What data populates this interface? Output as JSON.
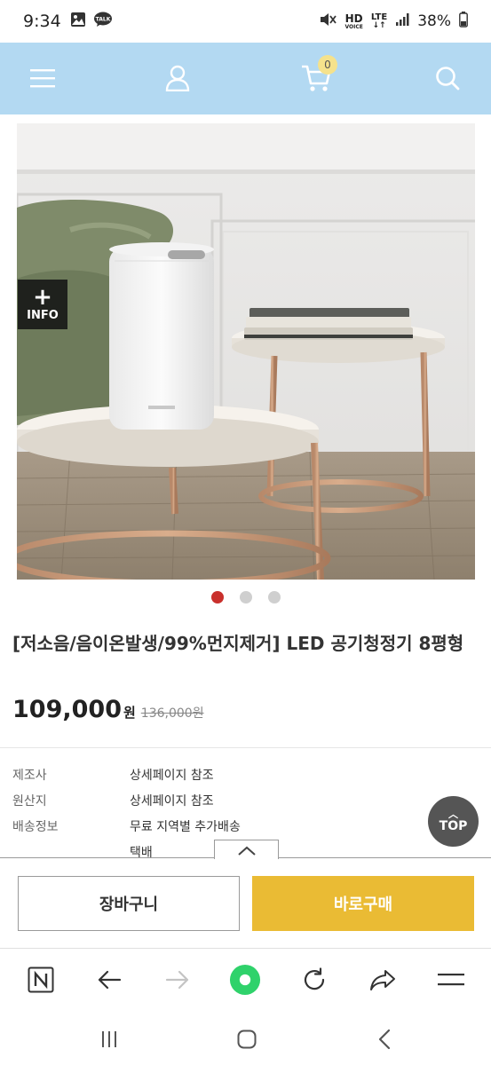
{
  "status_bar": {
    "time": "9:34",
    "battery": "38%",
    "hd_label": "HD",
    "voice_label": "VOICE",
    "lte_label": "LTE"
  },
  "header": {
    "cart_count": "0",
    "icons": [
      "menu-icon",
      "user-icon",
      "cart-icon",
      "search-icon"
    ]
  },
  "hero": {
    "info_button_label": "INFO",
    "slide_count": 3,
    "active_slide": 1
  },
  "product": {
    "title": "[저소음/음이온발생/99%먼지제거] LED 공기청정기 8평형",
    "price": "109,000",
    "currency": "원",
    "original_price": "136,000원"
  },
  "info_table": [
    {
      "key": "제조사",
      "value": "상세페이지 참조"
    },
    {
      "key": "원산지",
      "value": "상세페이지 참조"
    },
    {
      "key": "배송정보",
      "value": "무료 지역별 추가배송"
    },
    {
      "key": "",
      "value": "택배"
    }
  ],
  "top_button": {
    "label": "TOP"
  },
  "actions": {
    "cart_label": "장바구니",
    "buy_label": "바로구매"
  },
  "colors": {
    "header_bg": "#b3d9f2",
    "buy_button": "#eabb34",
    "active_dot": "#c9302c",
    "browser_home_green": "#2fd26b"
  }
}
